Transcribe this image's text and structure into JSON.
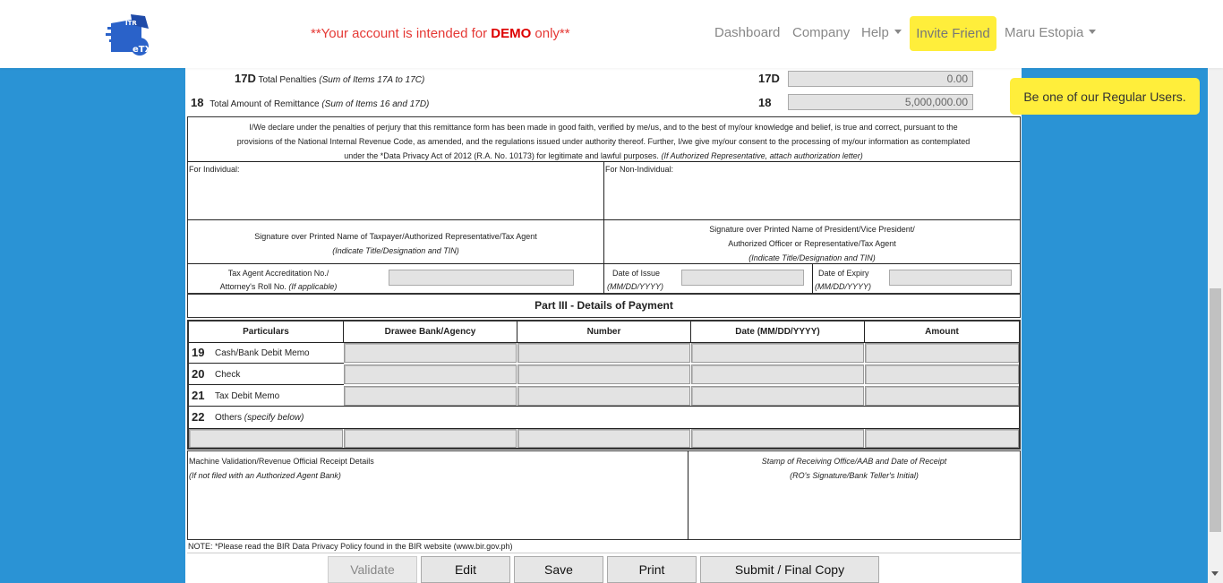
{
  "nav": {
    "demo_prefix": "**Your account is intended for ",
    "demo_word": "DEMO",
    "demo_suffix": " only**",
    "dashboard": "Dashboard",
    "company": "Company",
    "help": "Help",
    "invite": "Invite Friend",
    "user": "Maru Estopia",
    "logo_text_top": "ITR",
    "logo_text": "eTX"
  },
  "toast": "Be one of our Regular Users.",
  "form": {
    "item17d": {
      "no": "17D",
      "label": "Total Penalties",
      "note": "(Sum of Items 17A to 17C)",
      "code": "17D",
      "value": "0.00"
    },
    "item18": {
      "no": "18",
      "label": "Total Amount of Remittance",
      "note": "(Sum of Items 16 and 17D)",
      "code": "18",
      "value": "5,000,000.00"
    },
    "declaration_1": "I/We declare under the penalties of perjury that this remittance form has been made in good faith, verified by me/us, and to the best of my/our knowledge and belief, is true and correct, pursuant to the",
    "declaration_2": "provisions of the National Internal Revenue Code, as amended, and the regulations issued under authority thereof. Further, I/we give my/our consent to the processing of my/our information as contemplated",
    "declaration_3": "under the *Data Privacy Act of 2012 (R.A. No. 10173) for legitimate and lawful purposes.",
    "declaration_3_italic": "(If Authorized Representative, attach authorization letter)",
    "for_individual": "For Individual:",
    "for_non_individual": "For Non-Individual:",
    "sig_individual": "Signature over Printed Name of Taxpayer/Authorized Representative/Tax Agent",
    "sig_individual_note": "(Indicate Title/Designation and TIN)",
    "sig_nonind_1": "Signature over Printed Name of President/Vice President/",
    "sig_nonind_2": "Authorized Officer or Representative/Tax Agent",
    "sig_nonind_note": "(Indicate Title/Designation and TIN)",
    "tax_agent_1": "Tax Agent Accreditation No./",
    "tax_agent_2": "Attorney's Roll No.",
    "tax_agent_note": "(If applicable)",
    "date_issue": "Date of Issue",
    "date_issue_fmt": "(MM/DD/YYYY)",
    "date_expiry": "Date of Expiry",
    "date_expiry_fmt": "(MM/DD/YYYY)",
    "part3_title": "Part III - Details of Payment",
    "columns": [
      "Particulars",
      "Drawee Bank/Agency",
      "Number",
      "Date (MM/DD/YYYY)",
      "Amount"
    ],
    "rows": [
      {
        "no": "19",
        "label": "Cash/Bank Debit Memo",
        "italic": ""
      },
      {
        "no": "20",
        "label": "Check",
        "italic": ""
      },
      {
        "no": "21",
        "label": "Tax Debit Memo",
        "italic": ""
      },
      {
        "no": "22",
        "label": "Others",
        "italic": "(specify below)"
      }
    ],
    "machine_validation": "Machine Validation/Revenue Official Receipt Details",
    "machine_validation_note": "(If not filed with an Authorized Agent Bank)",
    "stamp": "Stamp of Receiving Office/AAB and Date of Receipt",
    "stamp_note": "(RO's Signature/Bank Teller's Initial)",
    "note": "NOTE: *Please read the BIR Data Privacy Policy found in the BIR website (www.bir.gov.ph)"
  },
  "buttons": {
    "validate": "Validate",
    "edit": "Edit",
    "save": "Save",
    "print": "Print",
    "submit": "Submit / Final Copy"
  },
  "colors": {
    "background": "#2a93d5",
    "highlight": "#ffee3b",
    "demo": "#e53935",
    "field": "#e3e3e3"
  }
}
